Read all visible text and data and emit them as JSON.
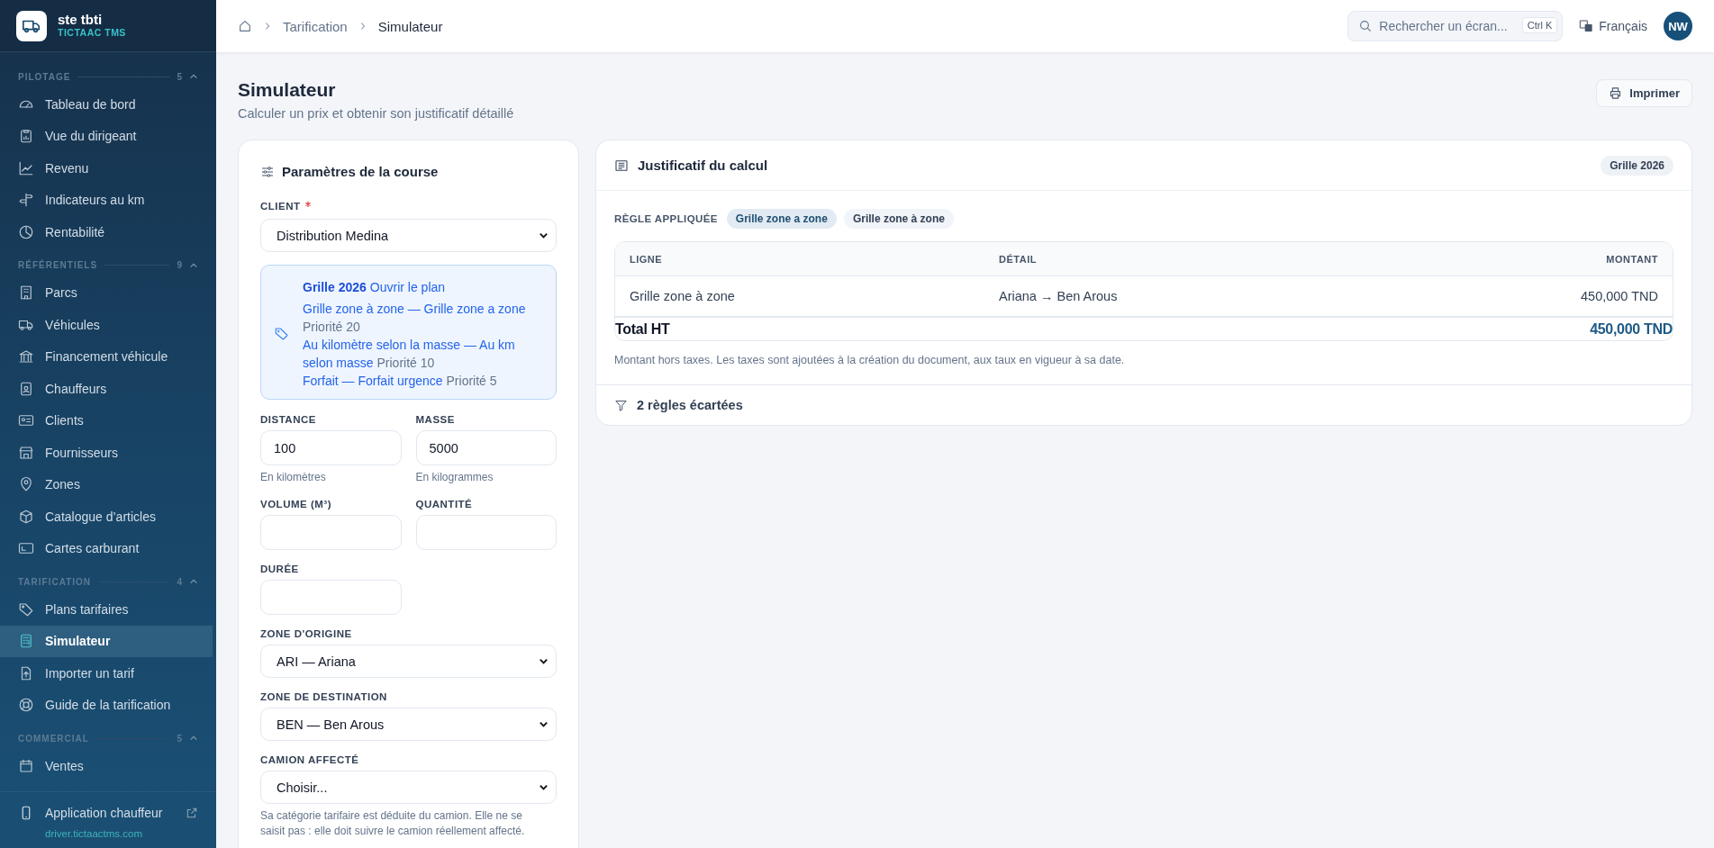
{
  "sidebar": {
    "brand": {
      "name": "ste tbti",
      "subtitle": "TICTAAC TMS"
    },
    "sections": [
      {
        "title": "PILOTAGE",
        "count": "5",
        "expanded": true,
        "items": [
          {
            "label": "Tableau de bord",
            "selected": false
          },
          {
            "label": "Vue du dirigeant",
            "selected": false
          },
          {
            "label": "Revenu",
            "selected": false
          },
          {
            "label": "Indicateurs au km",
            "selected": false
          },
          {
            "label": "Rentabilité",
            "selected": false
          }
        ]
      },
      {
        "title": "RÉFÉRENTIELS",
        "count": "9",
        "expanded": true,
        "items": [
          {
            "label": "Parcs",
            "selected": false
          },
          {
            "label": "Véhicules",
            "selected": false
          },
          {
            "label": "Financement véhicule",
            "selected": false
          },
          {
            "label": "Chauffeurs",
            "selected": false
          },
          {
            "label": "Clients",
            "selected": false
          },
          {
            "label": "Fournisseurs",
            "selected": false
          },
          {
            "label": "Zones",
            "selected": false
          },
          {
            "label": "Catalogue d’articles",
            "selected": false
          },
          {
            "label": "Cartes carburant",
            "selected": false
          }
        ]
      },
      {
        "title": "TARIFICATION",
        "count": "4",
        "expanded": true,
        "items": [
          {
            "label": "Plans tarifaires",
            "selected": false
          },
          {
            "label": "Simulateur",
            "selected": true
          },
          {
            "label": "Importer un tarif",
            "selected": false
          },
          {
            "label": "Guide de la tarification",
            "selected": false
          }
        ]
      },
      {
        "title": "COMMERCIAL",
        "count": "5",
        "expanded": true,
        "items": [
          {
            "label": "Ventes",
            "selected": false
          }
        ]
      }
    ],
    "footer": {
      "label": "Application chauffeur",
      "url": "driver.tictaactms.com"
    }
  },
  "topbar": {
    "breadcrumb": [
      "Tarification",
      "Simulateur"
    ],
    "search": {
      "placeholder": "Rechercher un écran...",
      "shortcut": "Ctrl K"
    },
    "language": "Français",
    "avatar": "NW"
  },
  "page": {
    "title": "Simulateur",
    "subtitle": "Calculer un prix et obtenir son justificatif détaillé",
    "print_button": "Imprimer"
  },
  "params": {
    "title": "Paramètres de la course",
    "client": {
      "label": "CLIENT",
      "required": true,
      "value": "Distribution Medina"
    },
    "plan_info": {
      "plan": "Grille 2026",
      "link": "Ouvrir le plan",
      "rules": [
        {
          "name": "Grille zone à zone — Grille zone a zone",
          "priority": "Priorité 20"
        },
        {
          "name": "Au kilomètre selon la masse — Au km selon masse",
          "priority": "Priorité 10"
        },
        {
          "name": "Forfait — Forfait urgence",
          "priority": "Priorité 5"
        }
      ]
    },
    "fields": [
      {
        "kind": "input",
        "label": "DISTANCE",
        "value": "100",
        "hint": "En kilomètres"
      },
      {
        "kind": "input",
        "label": "MASSE",
        "value": "5000",
        "hint": "En kilogrammes"
      },
      {
        "kind": "input",
        "label": "VOLUME (M³)"
      },
      {
        "kind": "input",
        "label": "QUANTITÉ"
      },
      {
        "kind": "input",
        "label": "DURÉE"
      },
      {
        "kind": "select",
        "label": "ZONE D'ORIGINE",
        "value": "ARI — Ariana"
      },
      {
        "kind": "select",
        "label": "ZONE DE DESTINATION",
        "value": "BEN — Ben Arous"
      },
      {
        "kind": "select",
        "label": "CAMION AFFECTÉ",
        "value": "Choisir...",
        "hint": "Sa catégorie tarifaire est déduite du camion. Elle ne se saisit pas : elle doit suivre le camion réellement affecté."
      }
    ]
  },
  "justification": {
    "title": "Justificatif du calcul",
    "badge": "Grille 2026",
    "rule_label": "RÈGLE APPLIQUÉE",
    "tags": [
      {
        "label": "Grille zone a zone",
        "selected": true
      },
      {
        "label": "Grille zone à zone",
        "selected": false
      }
    ],
    "table": {
      "columns": [
        "LIGNE",
        "DÉTAIL",
        "MONTANT"
      ],
      "rows": [
        [
          "Grille zone à zone",
          "Ariana → Ben Arous",
          "450,000 TND"
        ]
      ]
    },
    "total": {
      "label": "Total HT",
      "value": "450,000 TND"
    },
    "note": "Montant hors taxes. Les taxes sont ajoutées à la création du document, aux taux en vigueur à sa date.",
    "discarded": "2 règles écartées"
  }
}
